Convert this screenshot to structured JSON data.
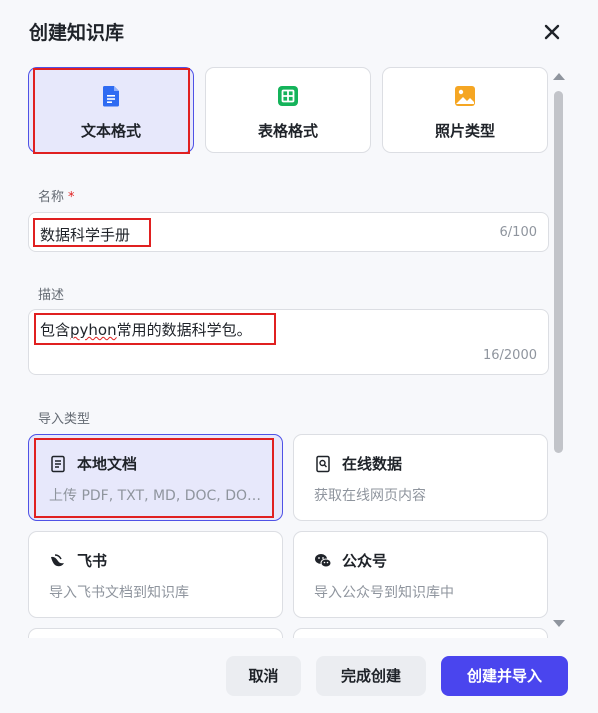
{
  "dialog": {
    "title": "创建知识库"
  },
  "formats": [
    {
      "label": "文本格式",
      "icon": "document-icon",
      "color": "#2f6bf2"
    },
    {
      "label": "表格格式",
      "icon": "spreadsheet-icon",
      "color": "#14b35a"
    },
    {
      "label": "照片类型",
      "icon": "image-icon",
      "color": "#f5a623"
    }
  ],
  "name_field": {
    "label": "名称",
    "required_mark": "*",
    "value": "数据科学手册",
    "counter": "6/100"
  },
  "desc_field": {
    "label": "描述",
    "value_pre": "包含",
    "value_typo": "pyhon",
    "value_post": "常用的数据科学包。",
    "counter": "16/2000"
  },
  "import_section": {
    "label": "导入类型",
    "items": [
      {
        "name": "本地文档",
        "desc": "上传 PDF, TXT, MD, DOC, DOCX 格式的本地文件",
        "icon": "file-icon"
      },
      {
        "name": "在线数据",
        "desc": "获取在线网页内容",
        "icon": "web-page-icon"
      },
      {
        "name": "飞书",
        "desc": "导入飞书文档到知识库",
        "icon": "feishu-icon"
      },
      {
        "name": "公众号",
        "desc": "导入公众号到知识库中",
        "icon": "wechat-icon"
      }
    ]
  },
  "footer": {
    "cancel": "取消",
    "finish": "完成创建",
    "create_import": "创建并导入"
  },
  "colors": {
    "accent": "#4a45ee",
    "highlight": "#e02020"
  }
}
